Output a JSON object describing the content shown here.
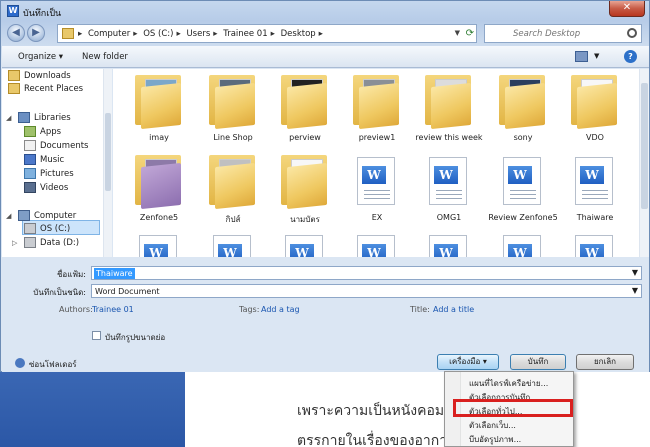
{
  "window": {
    "title": "บันทึกเป็น",
    "close_glyph": "✕"
  },
  "address": {
    "crumbs": [
      "Computer",
      "OS (C:)",
      "Users",
      "Trainee 01",
      "Desktop"
    ],
    "search_placeholder": "Search Desktop"
  },
  "toolbar": {
    "organize": "Organize ▾",
    "new_folder": "New folder",
    "help": "?"
  },
  "nav_pane": {
    "favorites": [
      "Downloads",
      "Recent Places"
    ],
    "libraries_label": "Libraries",
    "libraries": [
      "Apps",
      "Documents",
      "Music",
      "Pictures",
      "Videos"
    ],
    "computer_label": "Computer",
    "drives": [
      "OS (C:)",
      "Data (D:)"
    ]
  },
  "files": {
    "row1": [
      "imay",
      "Line Shop",
      "perview",
      "preview1",
      "review this week",
      "sony",
      "VDO"
    ],
    "row2": [
      "Zenfone5",
      "กิปส์",
      "นามบัตร",
      "EX",
      "OMG1",
      "Review Zenfone5",
      "Thaiware"
    ]
  },
  "fields": {
    "filename_label": "ชื่อแฟ้ม:",
    "filename_value": "Thaiware",
    "filetype_label": "บันทึกเป็นชนิด:",
    "filetype_value": "Word Document",
    "authors_label": "Authors:",
    "authors_value": "Trainee 01",
    "tags_label": "Tags:",
    "tags_value": "Add a tag",
    "title_label": "Title:",
    "title_value": "Add a title",
    "thumbnail_label": "บันทึกรูปขนาดย่อ",
    "hide_folders_label": "ซ่อนโฟลเดอร์"
  },
  "buttons": {
    "tools": "เครื่องมือ  ▾",
    "save": "บันทึก",
    "cancel": "ยกเลิก"
  },
  "tools_menu": {
    "items": [
      "แผนที่ไดรฟ์เครือข่าย...",
      "ตัวเลือกการบันทึก...",
      "ตัวเลือกทั่วไป...",
      "ตัวเลือกเว็บ...",
      "บีบอัดรูปภาพ..."
    ]
  },
  "background_doc": {
    "line1": "เพราะความเป็นหนังคอม                        ใหญ่จึงต้องที",
    "line2": "ตรรกายในเรื่องของอากา                       ช่น เกิดเหตุ"
  },
  "colors": {
    "selection": "#3399ff",
    "highlight_box": "#d9201f",
    "link": "#1a56b0"
  }
}
